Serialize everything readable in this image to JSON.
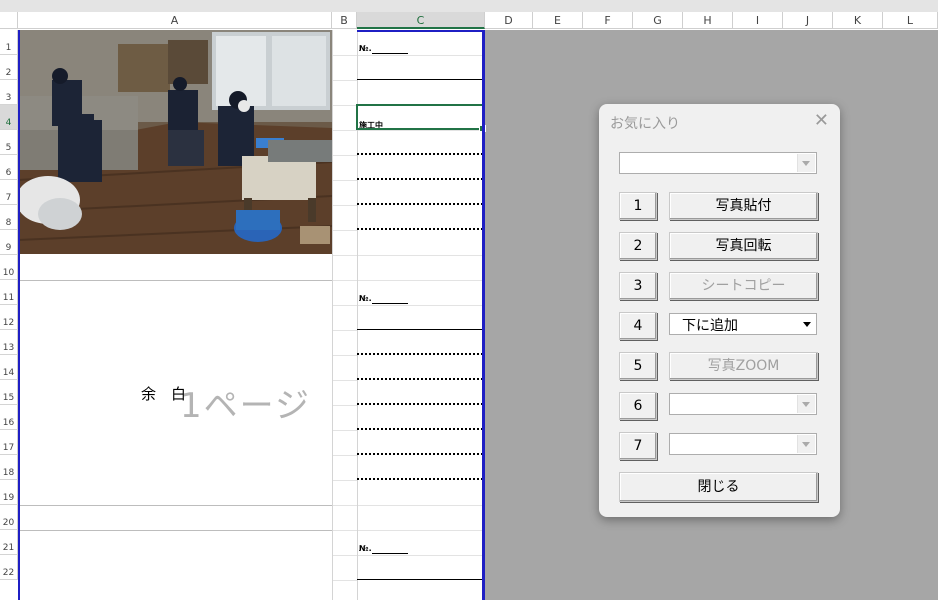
{
  "sheet": {
    "columns": [
      "A",
      "B",
      "C",
      "D",
      "E",
      "F",
      "G",
      "H",
      "I",
      "J",
      "K",
      "L"
    ],
    "rows": [
      "1",
      "2",
      "3",
      "4",
      "5",
      "6",
      "7",
      "8",
      "9",
      "10",
      "11",
      "12",
      "13",
      "14",
      "15",
      "16",
      "17",
      "18",
      "19",
      "20",
      "21",
      "22"
    ],
    "no_label": "№.",
    "work_label": "施工中",
    "margin_text": "余　白",
    "page_watermark": "1ページ"
  },
  "dialog": {
    "title": "お気に入り",
    "close_icon": "close-icon",
    "top_combo_value": "",
    "rows": [
      {
        "num": "1",
        "action": "写真貼付",
        "kind": "button",
        "enabled": true
      },
      {
        "num": "2",
        "action": "写真回転",
        "kind": "button",
        "enabled": true
      },
      {
        "num": "3",
        "action": "シートコピー",
        "kind": "button",
        "enabled": false
      },
      {
        "num": "4",
        "action": "下に追加",
        "kind": "combo",
        "enabled": true
      },
      {
        "num": "5",
        "action": "写真ZOOM",
        "kind": "button",
        "enabled": false
      },
      {
        "num": "6",
        "action": "",
        "kind": "combo",
        "enabled": false
      },
      {
        "num": "7",
        "action": "",
        "kind": "combo",
        "enabled": false
      }
    ],
    "close_button": "閉じる"
  },
  "colors": {
    "selection_green": "#217346",
    "print_border_blue": "#1f1fc4",
    "background_gray": "#a6a6a6"
  }
}
